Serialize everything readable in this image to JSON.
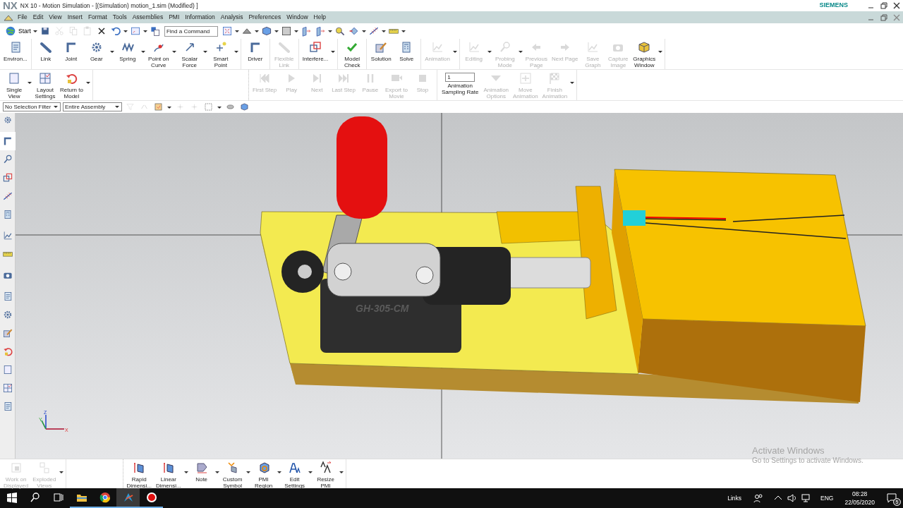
{
  "title_bar": {
    "logo": "NX",
    "title": "NX 10 - Motion Simulation - [(Simulation) motion_1.sim (Modified) ]",
    "brand": "SIEMENS"
  },
  "menu": [
    "File",
    "Edit",
    "View",
    "Insert",
    "Format",
    "Tools",
    "Assemblies",
    "PMI",
    "Information",
    "Analysis",
    "Preferences",
    "Window",
    "Help"
  ],
  "quick_toolbar": {
    "start": "Start",
    "find_command": {
      "placeholder": "Find a Command"
    },
    "before_find": [
      {
        "disabled": false,
        "dropdown": false
      },
      {
        "disabled": true,
        "dropdown": false
      },
      {
        "disabled": true,
        "dropdown": false
      },
      {
        "disabled": true,
        "dropdown": false
      },
      {
        "disabled": false,
        "dropdown": false
      },
      {
        "disabled": false,
        "dropdown": true
      },
      {
        "disabled": false,
        "dropdown": true
      },
      {
        "disabled": false,
        "dropdown": false
      }
    ],
    "after_find": [
      {
        "disabled": false,
        "dropdown": true
      },
      {
        "disabled": false,
        "dropdown": true
      },
      {
        "disabled": false,
        "dropdown": true
      },
      {
        "disabled": false,
        "dropdown": true
      },
      {
        "disabled": false,
        "dropdown": false
      },
      {
        "disabled": false,
        "dropdown": true
      },
      {
        "disabled": false,
        "dropdown": false
      },
      {
        "disabled": false,
        "dropdown": true
      },
      {
        "disabled": false,
        "dropdown": true
      },
      {
        "disabled": false,
        "dropdown": true
      }
    ]
  },
  "ribbon_top": [
    [
      {
        "label": "Environ...",
        "disabled": false,
        "dropdown": false
      }
    ],
    [
      {
        "label": "Link",
        "disabled": false,
        "dropdown": false
      },
      {
        "label": "Joint",
        "disabled": false,
        "dropdown": false
      },
      {
        "label": "Gear",
        "disabled": false,
        "dropdown": true
      },
      {
        "label": "Spring",
        "disabled": false,
        "dropdown": true
      },
      {
        "label": "Point on\nCurve",
        "disabled": false,
        "dropdown": true
      },
      {
        "label": "Scalar\nForce",
        "disabled": false,
        "dropdown": true
      },
      {
        "label": "Smart\nPoint",
        "disabled": false,
        "dropdown": true
      }
    ],
    [
      {
        "label": "Driver",
        "disabled": false,
        "dropdown": false
      }
    ],
    [
      {
        "label": "Flexible\nLink",
        "disabled": true,
        "dropdown": false
      }
    ],
    [
      {
        "label": "Interfere...",
        "disabled": false,
        "dropdown": true
      }
    ],
    [
      {
        "label": "Model\nCheck",
        "disabled": false,
        "dropdown": false
      }
    ],
    [
      {
        "label": "Solution",
        "disabled": false,
        "dropdown": false
      },
      {
        "label": "Solve",
        "disabled": false,
        "dropdown": false
      }
    ],
    [
      {
        "label": "Animation",
        "disabled": true,
        "dropdown": true
      }
    ],
    [
      {
        "label": "Editing",
        "disabled": true,
        "dropdown": true
      },
      {
        "label": "Probing\nMode",
        "disabled": true,
        "dropdown": true
      },
      {
        "label": "Previous\nPage",
        "disabled": true,
        "dropdown": false
      },
      {
        "label": "Next Page",
        "disabled": true,
        "dropdown": false
      },
      {
        "label": "Save\nGraph",
        "disabled": true,
        "dropdown": false
      },
      {
        "label": "Capture\nImage",
        "disabled": true,
        "dropdown": false
      },
      {
        "label": "Graphics\nWindow",
        "disabled": false,
        "dropdown": true
      }
    ]
  ],
  "ribbon_bottom": {
    "layout": [
      {
        "label": "Single\nView",
        "disabled": false,
        "dropdown": true
      },
      {
        "label": "Layout\nSettings",
        "disabled": false,
        "dropdown": false
      },
      {
        "label": "Return to\nModel",
        "disabled": false,
        "dropdown": true
      }
    ],
    "playback": [
      {
        "label": "First Step",
        "disabled": true,
        "dropdown": false
      },
      {
        "label": "Play",
        "disabled": true,
        "dropdown": false
      },
      {
        "label": "Next",
        "disabled": true,
        "dropdown": false
      },
      {
        "label": "Last Step",
        "disabled": true,
        "dropdown": false
      },
      {
        "label": "Pause",
        "disabled": true,
        "dropdown": false
      },
      {
        "label": "Export to\nMovie",
        "disabled": true,
        "dropdown": false
      },
      {
        "label": "Stop",
        "disabled": true,
        "dropdown": false
      }
    ],
    "sampling": {
      "value": "1",
      "label": "Animation\nSampling Rate"
    },
    "animation": [
      {
        "label": "Animation\nOptions",
        "disabled": true,
        "dropdown": false
      },
      {
        "label": "Move\nAnimation",
        "disabled": true,
        "dropdown": false
      },
      {
        "label": "Finish\nAnimation",
        "disabled": true,
        "dropdown": true
      }
    ]
  },
  "selection_bar": {
    "filter": "No Selection Filter",
    "scope": "Entire Assembly",
    "tools": [
      {
        "disabled": true,
        "dropdown": false
      },
      {
        "disabled": true,
        "dropdown": false
      },
      {
        "disabled": false,
        "dropdown": true
      },
      {
        "disabled": true,
        "dropdown": false
      },
      {
        "disabled": true,
        "dropdown": false
      },
      {
        "disabled": false,
        "dropdown": true
      },
      {
        "disabled": false,
        "dropdown": false
      },
      {
        "disabled": false,
        "dropdown": false
      }
    ]
  },
  "resource_bar": [
    {
      "selected": true
    },
    {
      "selected": false
    },
    {
      "selected": false
    },
    {
      "selected": false
    },
    {
      "selected": false
    },
    {
      "selected": false
    },
    {
      "selected": false
    },
    {
      "selected": false
    },
    {
      "selected": false
    },
    {
      "selected": false
    },
    {
      "selected": false
    },
    {
      "selected": false
    },
    {
      "selected": false
    },
    {
      "selected": false
    },
    {
      "selected": false
    }
  ],
  "viewport": {
    "part_marking": "GH-305-CM",
    "triad": {
      "x": "X",
      "y": "Y",
      "z": "Z"
    }
  },
  "bottom_toolbar": [
    [
      {
        "label": "Work on\nDisplayed",
        "disabled": true,
        "dropdown": false
      },
      {
        "label": "Exploded\nViews",
        "disabled": true,
        "dropdown": true
      }
    ],
    [
      {
        "label": "Rapid\nDimensi...",
        "disabled": false,
        "dropdown": false
      },
      {
        "label": "Linear\nDimensi...",
        "disabled": false,
        "dropdown": true
      },
      {
        "label": "Note",
        "disabled": false,
        "dropdown": true
      },
      {
        "label": "Custom\nSymbol",
        "disabled": false,
        "dropdown": true
      },
      {
        "label": "PMI\nRegion",
        "disabled": false,
        "dropdown": true
      },
      {
        "label": "Edit\nSettings",
        "disabled": false,
        "dropdown": true
      },
      {
        "label": "Resize\nPMI",
        "disabled": false,
        "dropdown": true
      }
    ]
  ],
  "activation_notice": {
    "title": "Activate Windows",
    "text": "Go to Settings to activate Windows."
  },
  "taskbar": {
    "apps": [
      {
        "selected": false
      },
      {
        "selected": false
      },
      {
        "selected": true
      },
      {
        "selected": false
      }
    ],
    "links": "Links",
    "language": "ENG",
    "time": "08:28",
    "date": "22/05/2020",
    "notifications": "5"
  }
}
